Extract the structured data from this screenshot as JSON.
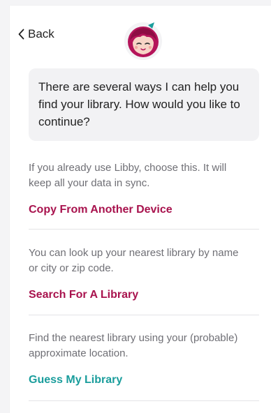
{
  "nav": {
    "back_label": "Back"
  },
  "assistant": {
    "message": "There are several ways I can help you find your library. How would you like to continue?"
  },
  "options": [
    {
      "description": "If you already use Libby, choose this. It will keep all your data in sync.",
      "action_label": "Copy From Another Device",
      "action_color": "#a8124d"
    },
    {
      "description": "You can look up your nearest library by name or city or zip code.",
      "action_label": "Search For A Library",
      "action_color": "#a8124d"
    },
    {
      "description": "Find the nearest library using your (probable) approximate location.",
      "action_label": "Guess My Library",
      "action_color": "#1a9d9c"
    }
  ],
  "colors": {
    "brand_magenta": "#a8124d",
    "brand_teal": "#1a9d9c"
  }
}
